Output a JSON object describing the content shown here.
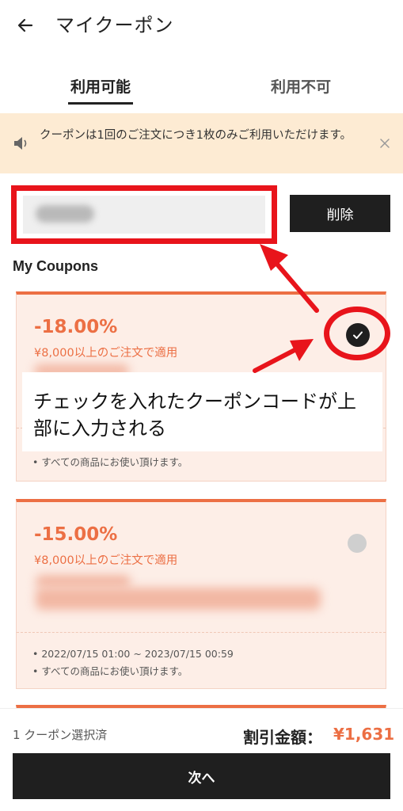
{
  "header": {
    "title": "マイクーポン",
    "back_icon": "arrow-left-icon"
  },
  "tabs": [
    {
      "label": "利用可能",
      "active": true
    },
    {
      "label": "利用不可",
      "active": false
    }
  ],
  "notice": {
    "text": "クーポンは1回のご注文につき1枚のみご利用いただけます。",
    "icon": "speaker-icon",
    "close_icon": "close-icon",
    "background": "#fdebd3"
  },
  "code_input": {
    "value": "",
    "delete_label": "削除"
  },
  "section_title": "My Coupons",
  "coupons": [
    {
      "discount": "-18.00%",
      "condition": "¥8,000以上のご注文で適用",
      "period": "",
      "scope": "• すべての商品にお使い頂けます。",
      "selected": true
    },
    {
      "discount": "-15.00%",
      "condition": "¥8,000以上のご注文で適用",
      "period": "• 2022/07/15  01:00 ~ 2023/07/15  00:59",
      "scope": "• すべての商品にお使い頂けます。",
      "selected": false
    }
  ],
  "annotation": {
    "text": "チェックを入れたクーポンコードが上部に入力される"
  },
  "footer": {
    "selected_count": "1 クーポン選択済",
    "total_label": "割引金額：",
    "total_value": "¥1,631",
    "next_label": "次へ"
  },
  "colors": {
    "accent": "#ec6f44",
    "highlight": "#e8141b",
    "dark": "#1f1f1f"
  }
}
